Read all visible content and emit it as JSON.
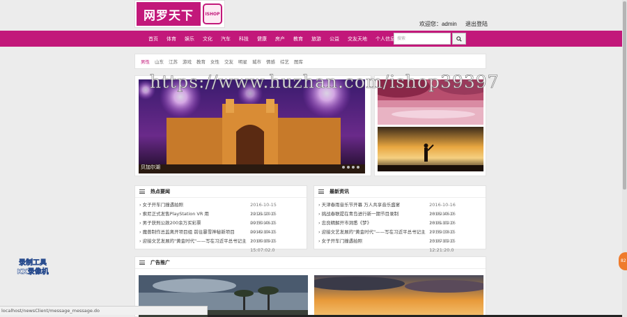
{
  "logo": {
    "title": "网罗天下",
    "seal_text": "ISHOP"
  },
  "user": {
    "welcome": "欢迎您：admin",
    "logout": "退出登陆"
  },
  "nav": {
    "items": [
      "首页",
      "体育",
      "娱乐",
      "文化",
      "汽车",
      "科技",
      "健康",
      "房产",
      "教育",
      "旅游",
      "公益",
      "交友天地",
      "个人信息"
    ],
    "search_placeholder": "搜索"
  },
  "categories": {
    "active": "男性",
    "items": [
      "山东",
      "江苏",
      "游戏",
      "教育",
      "女性",
      "交友",
      "明星",
      "城市",
      "情感",
      "综艺",
      "图库"
    ]
  },
  "slider": {
    "caption": "贝加尔湖",
    "dot_count": 4
  },
  "watermark": "https://www.huzhan.com/ishop39397",
  "hot_news": {
    "title": "热点要闻",
    "items": [
      {
        "text": "女子开车门撞遇拍照",
        "date": "2016-10-15 12:21:20.0"
      },
      {
        "text": "索尼正式发售PlayStation VR 用",
        "date": "2016-10-15 09:50:46.0"
      },
      {
        "text": "男子获刑公款200余万买彩票",
        "date": "2016-10-15 09:42:04.0"
      },
      {
        "text": "魔兽制作总监离开项目组 前往暴雪神秘新项目",
        "date": "2016-10-15 10:00:09.0"
      },
      {
        "text": "迎接文艺发展的\"黄金时代\"——写在习近平总书记主",
        "date": "2016-10-15 15:07:02.0"
      }
    ]
  },
  "latest_news": {
    "title": "最新资讯",
    "items": [
      {
        "text": "天津春雨音乐节开幕 万人共享音乐盛宴",
        "date": "2016-10-16 18:02:46.0"
      },
      {
        "text": "挑战春联提在青岛进行新一期节目录制",
        "date": "2016-10-16 18:01:02.0"
      },
      {
        "text": "忠良精解开市洞悉《梦》",
        "date": "2016-10-16 17:59:38.0"
      },
      {
        "text": "迎接文艺发展的\"黄金时代\"——写在习近平总书记主",
        "date": "2016-10-15 15:07:02.0"
      },
      {
        "text": "女子开车门撞遇拍照",
        "date": "2016-10-15 12:21:20.0"
      }
    ]
  },
  "ads": {
    "title": "广告推广"
  },
  "recorder": {
    "line1": "录制工具",
    "line2": "KK录像机"
  },
  "status_url": "localhost/newsClient/message_message.do",
  "float_button": "82"
}
